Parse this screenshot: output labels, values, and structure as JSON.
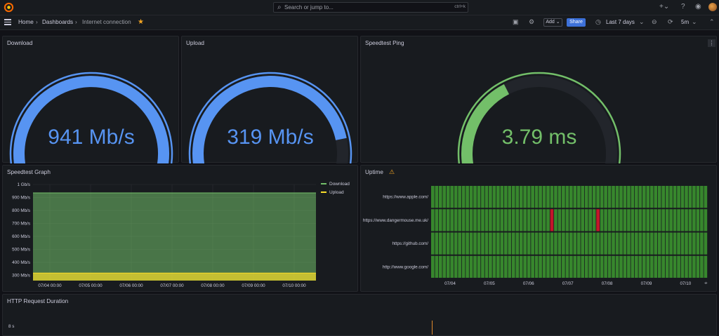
{
  "search": {
    "placeholder": "Search or jump to...",
    "shortcut": "ctrl+k"
  },
  "breadcrumb": {
    "home": "Home",
    "dashboards": "Dashboards",
    "current": "Internet connection"
  },
  "toolbar": {
    "add_label": "Add",
    "share_label": "Share",
    "time_range": "Last 7 days",
    "refresh_interval": "5m"
  },
  "panels": {
    "download": {
      "title": "Download",
      "value": "941 Mb/s",
      "fraction": 0.94,
      "color": "#5794f2"
    },
    "upload": {
      "title": "Upload",
      "value": "319 Mb/s",
      "fraction": 0.85,
      "color": "#5794f2"
    },
    "ping": {
      "title": "Speedtest Ping",
      "value": "3.79 ms",
      "fraction": 0.38,
      "color": "#73bf69"
    },
    "graph": {
      "title": "Speedtest Graph"
    },
    "uptime": {
      "title": "Uptime"
    },
    "http": {
      "title": "HTTP Request Duration",
      "ytick": "8 s"
    }
  },
  "chart_data": [
    {
      "type": "area",
      "title": "Speedtest Graph",
      "yticks": [
        "1 Gb/s",
        "900 Mb/s",
        "800 Mb/s",
        "700 Mb/s",
        "600 Mb/s",
        "500 Mb/s",
        "400 Mb/s",
        "300 Mb/s"
      ],
      "xticks": [
        "07/04 00:00",
        "07/05 00:00",
        "07/06 00:00",
        "07/07 00:00",
        "07/08 00:00",
        "07/09 00:00",
        "07/10 00:00"
      ],
      "ylim": [
        260,
        1000
      ],
      "legend_position": "right",
      "series": [
        {
          "name": "Download",
          "color": "#73bf69",
          "value": 935
        },
        {
          "name": "Upload",
          "color": "#fade2a",
          "value": 318
        }
      ]
    },
    {
      "type": "heatmap",
      "title": "Uptime",
      "rows": [
        "https://www.apple.com/",
        "https://www.dangermouse.me.uk/",
        "https://github.com/",
        "http://www.google.com/"
      ],
      "xticks": [
        "07/04",
        "07/05",
        "07/06",
        "07/07",
        "07/08",
        "07/09",
        "07/10"
      ],
      "columns": 72,
      "up_color": "#37872d",
      "down_color": "#c4162a",
      "down_cells": [
        {
          "row": 1,
          "col": 31
        },
        {
          "row": 1,
          "col": 43
        }
      ]
    }
  ]
}
